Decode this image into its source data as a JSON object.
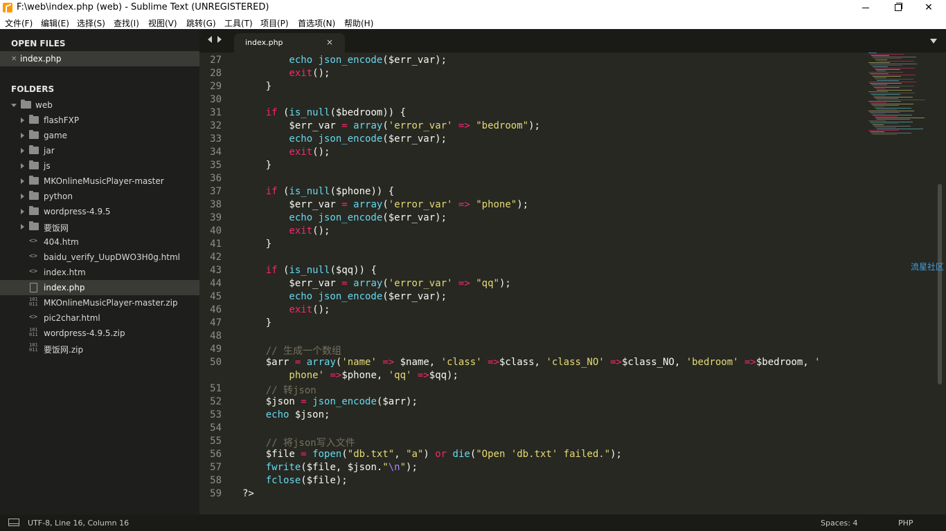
{
  "window": {
    "title": "F:\\web\\index.php (web) - Sublime Text (UNREGISTERED)",
    "minimize_glyph": "",
    "maximize_glyph": "",
    "close_glyph": "✕"
  },
  "menu": [
    "文件(F)",
    "编辑(E)",
    "选择(S)",
    "查找(I)",
    "视图(V)",
    "跳转(G)",
    "工具(T)",
    "项目(P)",
    "首选项(N)",
    "帮助(H)"
  ],
  "sidebar": {
    "open_files_heading": "OPEN FILES",
    "open_files": [
      "index.php"
    ],
    "folders_heading": "FOLDERS",
    "root": "web",
    "items": [
      {
        "label": "flashFXP",
        "type": "folder"
      },
      {
        "label": "game",
        "type": "folder"
      },
      {
        "label": "jar",
        "type": "folder"
      },
      {
        "label": "js",
        "type": "folder"
      },
      {
        "label": "MKOnlineMusicPlayer-master",
        "type": "folder"
      },
      {
        "label": "python",
        "type": "folder"
      },
      {
        "label": "wordpress-4.9.5",
        "type": "folder"
      },
      {
        "label": "要饭网",
        "type": "folder"
      },
      {
        "label": "404.htm",
        "type": "code"
      },
      {
        "label": "baidu_verify_UupDWO3H0g.html",
        "type": "code"
      },
      {
        "label": "index.htm",
        "type": "code"
      },
      {
        "label": "index.php",
        "type": "file"
      },
      {
        "label": "MKOnlineMusicPlayer-master.zip",
        "type": "binary"
      },
      {
        "label": "pic2char.html",
        "type": "code"
      },
      {
        "label": "wordpress-4.9.5.zip",
        "type": "binary"
      },
      {
        "label": "要饭网.zip",
        "type": "binary"
      }
    ]
  },
  "tabs": {
    "active": "index.php",
    "close_glyph": "×"
  },
  "editor": {
    "line_numbers": [
      "27",
      "28",
      "29",
      "30",
      "31",
      "32",
      "33",
      "34",
      "35",
      "36",
      "37",
      "38",
      "39",
      "40",
      "41",
      "42",
      "43",
      "44",
      "45",
      "46",
      "47",
      "48",
      "49",
      "50",
      "",
      "51",
      "52",
      "53",
      "54",
      "55",
      "56",
      "57",
      "58",
      "59"
    ],
    "lines": [
      [
        [
          "t-fn",
          "        echo "
        ],
        [
          "t-fn",
          "json_encode"
        ],
        [
          "t-var",
          "($err_var);"
        ]
      ],
      [
        [
          "t-kw",
          "        exit"
        ],
        [
          "t-var",
          "();"
        ]
      ],
      [
        [
          "t-var",
          "    }"
        ]
      ],
      [
        [
          "t-var",
          ""
        ]
      ],
      [
        [
          "t-kw",
          "    if "
        ],
        [
          "t-var",
          "("
        ],
        [
          "t-fn",
          "is_null"
        ],
        [
          "t-var",
          "($bedroom)) {"
        ]
      ],
      [
        [
          "t-var",
          "        $err_var "
        ],
        [
          "t-op",
          "="
        ],
        [
          "t-var",
          " "
        ],
        [
          "t-fn",
          "array"
        ],
        [
          "t-var",
          "("
        ],
        [
          "t-str",
          "'error_var'"
        ],
        [
          "t-var",
          " "
        ],
        [
          "t-op",
          "=>"
        ],
        [
          "t-var",
          " "
        ],
        [
          "t-str",
          "\"bedroom\""
        ],
        [
          "t-var",
          ");"
        ]
      ],
      [
        [
          "t-fn",
          "        echo "
        ],
        [
          "t-fn",
          "json_encode"
        ],
        [
          "t-var",
          "($err_var);"
        ]
      ],
      [
        [
          "t-kw",
          "        exit"
        ],
        [
          "t-var",
          "();"
        ]
      ],
      [
        [
          "t-var",
          "    }"
        ]
      ],
      [
        [
          "t-var",
          ""
        ]
      ],
      [
        [
          "t-kw",
          "    if "
        ],
        [
          "t-var",
          "("
        ],
        [
          "t-fn",
          "is_null"
        ],
        [
          "t-var",
          "($phone)) {"
        ]
      ],
      [
        [
          "t-var",
          "        $err_var "
        ],
        [
          "t-op",
          "="
        ],
        [
          "t-var",
          " "
        ],
        [
          "t-fn",
          "array"
        ],
        [
          "t-var",
          "("
        ],
        [
          "t-str",
          "'error_var'"
        ],
        [
          "t-var",
          " "
        ],
        [
          "t-op",
          "=>"
        ],
        [
          "t-var",
          " "
        ],
        [
          "t-str",
          "\"phone\""
        ],
        [
          "t-var",
          ");"
        ]
      ],
      [
        [
          "t-fn",
          "        echo "
        ],
        [
          "t-fn",
          "json_encode"
        ],
        [
          "t-var",
          "($err_var);"
        ]
      ],
      [
        [
          "t-kw",
          "        exit"
        ],
        [
          "t-var",
          "();"
        ]
      ],
      [
        [
          "t-var",
          "    }"
        ]
      ],
      [
        [
          "t-var",
          ""
        ]
      ],
      [
        [
          "t-kw",
          "    if "
        ],
        [
          "t-var",
          "("
        ],
        [
          "t-fn",
          "is_null"
        ],
        [
          "t-var",
          "($qq)) {"
        ]
      ],
      [
        [
          "t-var",
          "        $err_var "
        ],
        [
          "t-op",
          "="
        ],
        [
          "t-var",
          " "
        ],
        [
          "t-fn",
          "array"
        ],
        [
          "t-var",
          "("
        ],
        [
          "t-str",
          "'error_var'"
        ],
        [
          "t-var",
          " "
        ],
        [
          "t-op",
          "=>"
        ],
        [
          "t-var",
          " "
        ],
        [
          "t-str",
          "\"qq\""
        ],
        [
          "t-var",
          ");"
        ]
      ],
      [
        [
          "t-fn",
          "        echo "
        ],
        [
          "t-fn",
          "json_encode"
        ],
        [
          "t-var",
          "($err_var);"
        ]
      ],
      [
        [
          "t-kw",
          "        exit"
        ],
        [
          "t-var",
          "();"
        ]
      ],
      [
        [
          "t-var",
          "    }"
        ]
      ],
      [
        [
          "t-var",
          ""
        ]
      ],
      [
        [
          "t-com",
          "    // 生成一个数组"
        ]
      ],
      [
        [
          "t-var",
          "    $arr "
        ],
        [
          "t-op",
          "="
        ],
        [
          "t-var",
          " "
        ],
        [
          "t-fn",
          "array"
        ],
        [
          "t-var",
          "("
        ],
        [
          "t-str",
          "'name'"
        ],
        [
          "t-var",
          " "
        ],
        [
          "t-op",
          "=>"
        ],
        [
          "t-var",
          " $name, "
        ],
        [
          "t-str",
          "'class'"
        ],
        [
          "t-var",
          " "
        ],
        [
          "t-op",
          "=>"
        ],
        [
          "t-var",
          "$class, "
        ],
        [
          "t-str",
          "'class_NO'"
        ],
        [
          "t-var",
          " "
        ],
        [
          "t-op",
          "=>"
        ],
        [
          "t-var",
          "$class_NO, "
        ],
        [
          "t-str",
          "'bedroom'"
        ],
        [
          "t-var",
          " "
        ],
        [
          "t-op",
          "=>"
        ],
        [
          "t-var",
          "$bedroom, "
        ],
        [
          "t-str",
          "'"
        ]
      ],
      [
        [
          "t-str",
          "        phone'"
        ],
        [
          "t-var",
          " "
        ],
        [
          "t-op",
          "=>"
        ],
        [
          "t-var",
          "$phone, "
        ],
        [
          "t-str",
          "'qq'"
        ],
        [
          "t-var",
          " "
        ],
        [
          "t-op",
          "=>"
        ],
        [
          "t-var",
          "$qq);"
        ]
      ],
      [
        [
          "t-com",
          "    // 转json"
        ]
      ],
      [
        [
          "t-var",
          "    $json "
        ],
        [
          "t-op",
          "="
        ],
        [
          "t-var",
          " "
        ],
        [
          "t-fn",
          "json_encode"
        ],
        [
          "t-var",
          "($arr);"
        ]
      ],
      [
        [
          "t-fn",
          "    echo"
        ],
        [
          "t-var",
          " $json;"
        ]
      ],
      [
        [
          "t-var",
          ""
        ]
      ],
      [
        [
          "t-com",
          "    // 将json写入文件"
        ]
      ],
      [
        [
          "t-var",
          "    $file "
        ],
        [
          "t-op",
          "="
        ],
        [
          "t-var",
          " "
        ],
        [
          "t-fn",
          "fopen"
        ],
        [
          "t-var",
          "("
        ],
        [
          "t-str",
          "\"db.txt\""
        ],
        [
          "t-var",
          ", "
        ],
        [
          "t-str",
          "\"a\""
        ],
        [
          "t-var",
          ") "
        ],
        [
          "t-kw",
          "or"
        ],
        [
          "t-var",
          " "
        ],
        [
          "t-fn",
          "die"
        ],
        [
          "t-var",
          "("
        ],
        [
          "t-str",
          "\"Open 'db.txt' failed.\""
        ],
        [
          "t-var",
          ");"
        ]
      ],
      [
        [
          "t-fn",
          "    fwrite"
        ],
        [
          "t-var",
          "($file, $json."
        ],
        [
          "t-str",
          "\""
        ],
        [
          "t-esc",
          "\\n"
        ],
        [
          "t-str",
          "\""
        ],
        [
          "t-var",
          ");"
        ]
      ],
      [
        [
          "t-fn",
          "    fclose"
        ],
        [
          "t-var",
          "($file);"
        ]
      ],
      [
        [
          "t-var",
          "?>"
        ]
      ]
    ]
  },
  "watermark": "流星社区",
  "status": {
    "left": "UTF-8, Line 16, Column 16",
    "spaces": "Spaces: 4",
    "syntax": "PHP"
  }
}
